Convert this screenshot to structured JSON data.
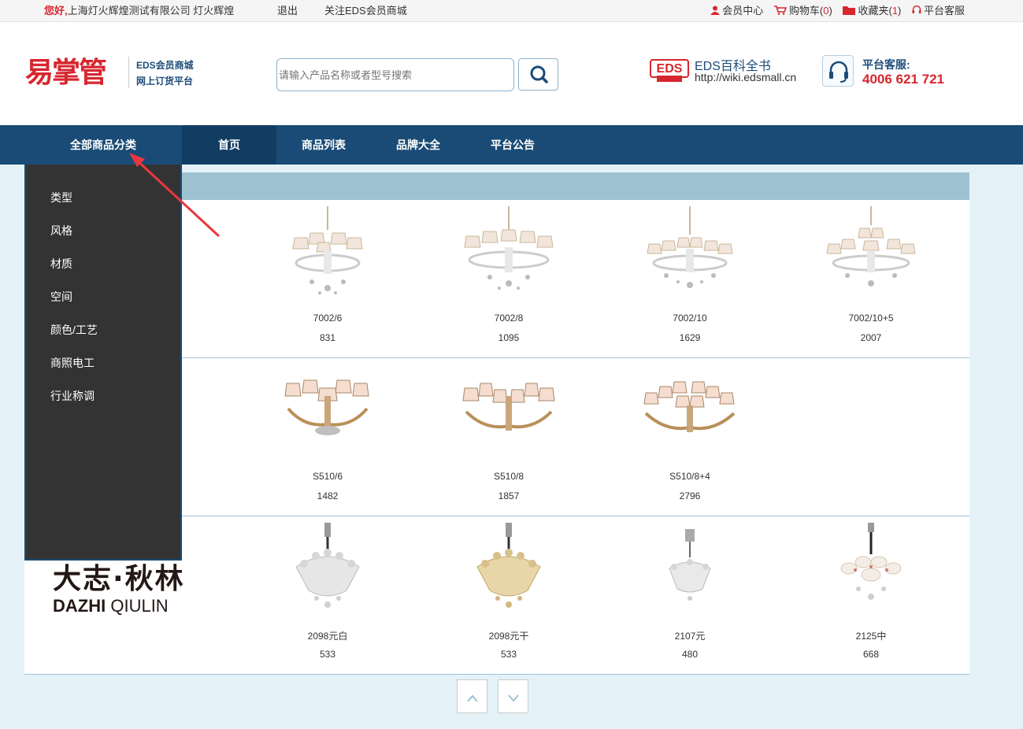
{
  "topbar": {
    "greeting": "您好,",
    "company": "上海灯火辉煌测试有限公司 灯火辉煌",
    "logout": "退出",
    "follow": "关注EDS会员商城",
    "member_center": "会员中心",
    "cart_label": "购物车(",
    "cart_count": "0",
    "cart_close": ")",
    "fav_label": "收藏夹(",
    "fav_count": "1",
    "fav_close": ")",
    "service": "平台客服"
  },
  "header": {
    "logo": "易掌管",
    "logo_sub1": "EDS会员商城",
    "logo_sub2": "网上订货平台",
    "search_placeholder": "请输入产品名称或者型号搜索",
    "eds_title": "EDS百科全书",
    "eds_url": "http://wiki.edsmall.cn",
    "hotline_label": "平台客服:",
    "hotline_phone": "4006 621 721"
  },
  "nav": {
    "all_categories": "全部商品分类",
    "items": [
      "首页",
      "商品列表",
      "品牌大全",
      "平台公告"
    ]
  },
  "dropdown": {
    "items": [
      "类型",
      "风格",
      "材质",
      "空间",
      "颜色/工艺",
      "商照电工",
      "行业称调"
    ]
  },
  "brand": {
    "cn": "大志·秋林",
    "en_bold": "DAZHI",
    "en_light": "QIULIN"
  },
  "products": [
    [
      {
        "model": "7002/6",
        "price": "831"
      },
      {
        "model": "7002/8",
        "price": "1095"
      },
      {
        "model": "7002/10",
        "price": "1629"
      },
      {
        "model": "7002/10+5",
        "price": "2007"
      }
    ],
    [
      {
        "model": "S510/6",
        "price": "1482"
      },
      {
        "model": "S510/8",
        "price": "1857"
      },
      {
        "model": "S510/8+4",
        "price": "2796"
      }
    ],
    [
      {
        "model": "2098元白",
        "price": "533"
      },
      {
        "model": "2098元干",
        "price": "533"
      },
      {
        "model": "2107元",
        "price": "480"
      },
      {
        "model": "2125中",
        "price": "668"
      }
    ]
  ],
  "pager": {
    "up": "^",
    "down": "v"
  },
  "colors": {
    "brand_red": "#d7262e",
    "nav_blue": "#1a4b76",
    "panel_head": "#9fc2d3",
    "dropdown_bg": "#333333"
  },
  "icons": [
    "user-icon",
    "cart-icon",
    "folder-icon",
    "headset-icon",
    "search-icon"
  ]
}
